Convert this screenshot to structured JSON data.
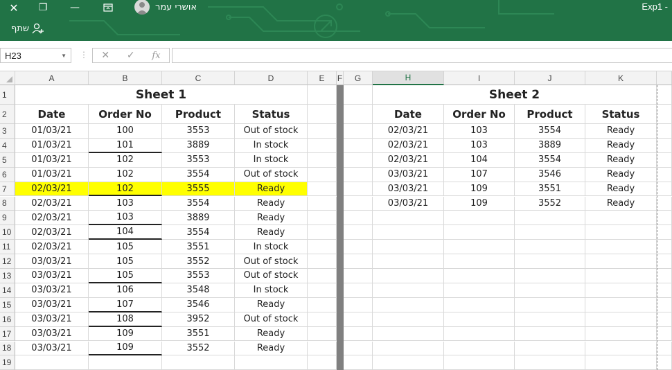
{
  "window": {
    "title": "Exp1 -",
    "user_name": "אושרי עמר",
    "share_label": "שתף"
  },
  "formula_bar": {
    "name_box": "H23",
    "formula": ""
  },
  "columns": [
    "A",
    "B",
    "C",
    "D",
    "E",
    "F",
    "G",
    "H",
    "I",
    "J",
    "K"
  ],
  "selected_column": "H",
  "rows": [
    "1",
    "2",
    "3",
    "4",
    "5",
    "6",
    "7",
    "8",
    "9",
    "10",
    "11",
    "12",
    "13",
    "14",
    "15",
    "16",
    "17",
    "18",
    "19"
  ],
  "sheet1": {
    "title": "Sheet 1",
    "headers": [
      "Date",
      "Order No",
      "Product",
      "Status"
    ],
    "records": [
      [
        "01/03/21",
        "100",
        "3553",
        "Out of stock"
      ],
      [
        "01/03/21",
        "101",
        "3889",
        "In stock"
      ],
      [
        "01/03/21",
        "102",
        "3553",
        "In stock"
      ],
      [
        "01/03/21",
        "102",
        "3554",
        "Out of stock"
      ],
      [
        "02/03/21",
        "102",
        "3555",
        "Ready"
      ],
      [
        "02/03/21",
        "103",
        "3554",
        "Ready"
      ],
      [
        "02/03/21",
        "103",
        "3889",
        "Ready"
      ],
      [
        "02/03/21",
        "104",
        "3554",
        "Ready"
      ],
      [
        "02/03/21",
        "105",
        "3551",
        "In stock"
      ],
      [
        "03/03/21",
        "105",
        "3552",
        "Out of stock"
      ],
      [
        "03/03/21",
        "105",
        "3553",
        "Out of stock"
      ],
      [
        "03/03/21",
        "106",
        "3548",
        "In stock"
      ],
      [
        "03/03/21",
        "107",
        "3546",
        "Ready"
      ],
      [
        "03/03/21",
        "108",
        "3952",
        "Out of stock"
      ],
      [
        "03/03/21",
        "109",
        "3551",
        "Ready"
      ],
      [
        "03/03/21",
        "109",
        "3552",
        "Ready"
      ]
    ],
    "highlighted_record": 4,
    "highlight_color": "#ffff00",
    "underlined_order_records": [
      1,
      4,
      6,
      7,
      10,
      12,
      13,
      15
    ]
  },
  "sheet2": {
    "title": "Sheet 2",
    "headers": [
      "Date",
      "Order No",
      "Product",
      "Status"
    ],
    "records": [
      [
        "02/03/21",
        "103",
        "3554",
        "Ready"
      ],
      [
        "02/03/21",
        "103",
        "3889",
        "Ready"
      ],
      [
        "02/03/21",
        "104",
        "3554",
        "Ready"
      ],
      [
        "03/03/21",
        "107",
        "3546",
        "Ready"
      ],
      [
        "03/03/21",
        "109",
        "3551",
        "Ready"
      ],
      [
        "03/03/21",
        "109",
        "3552",
        "Ready"
      ]
    ]
  },
  "colors": {
    "accent": "#217346"
  }
}
